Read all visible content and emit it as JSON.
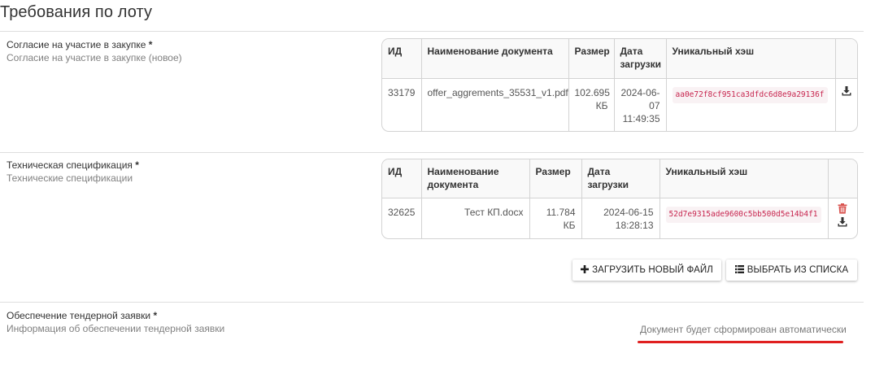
{
  "page_title": "Требования по лоту",
  "sections": [
    {
      "label": "Согласие на участие в закупке",
      "required_mark": "*",
      "sublabel": "Согласие на участие в закупке (новое)",
      "table": {
        "headers": [
          "ИД",
          "Наименование документа",
          "Размер",
          "Дата загрузки",
          "Уникальный хэш",
          ""
        ],
        "rows": [
          {
            "id": "33179",
            "name": "offer_aggrements_35531_v1.pdf",
            "size": "102.695 КБ",
            "date": "2024-06-07 11:49:35",
            "hash": "aa0e72f8cf951ca3dfdc6d8e9a29136f",
            "actions": [
              "download-icon"
            ]
          }
        ]
      }
    },
    {
      "label": "Техническая спецификация",
      "required_mark": "*",
      "sublabel": "Технические спецификации",
      "table": {
        "headers": [
          "ИД",
          "Наименование документа",
          "Размер",
          "Дата загрузки",
          "Уникальный хэш",
          ""
        ],
        "rows": [
          {
            "id": "32625",
            "name": "Тест КП.docx",
            "size": "11.784 КБ",
            "date": "2024-06-15 18:28:13",
            "hash": "52d7e9315ade9600c5bb500d5e14b4f1",
            "actions": [
              "trash-icon",
              "download-icon"
            ]
          }
        ]
      },
      "buttons": {
        "upload_label": "ЗАГРУЗИТЬ НОВЫЙ ФАЙЛ",
        "upload_icon": "plus-icon",
        "select_label": "ВЫБРАТЬ ИЗ СПИСКА",
        "select_icon": "list-icon"
      }
    },
    {
      "label": "Обеспечение тендерной заявки",
      "required_mark": "*",
      "sublabel": "Информация об обеспечении тендерной заявки",
      "auto_note": "Документ будет сформирован автоматически"
    }
  ],
  "colors": {
    "hash_text": "#c7254e",
    "hash_bg": "#f9f2f4",
    "delete_icon": "#d9534f",
    "highlight_underline": "#e02020"
  }
}
